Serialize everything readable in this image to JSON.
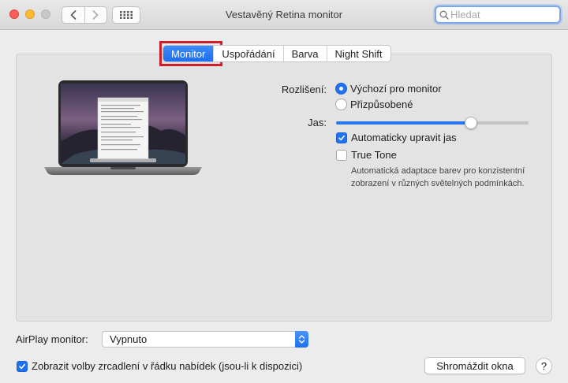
{
  "window": {
    "title": "Vestavěný Retina monitor",
    "search_placeholder": "Hledat"
  },
  "tabs": [
    {
      "label": "Monitor",
      "active": true
    },
    {
      "label": "Uspořádání",
      "active": false
    },
    {
      "label": "Barva",
      "active": false
    },
    {
      "label": "Night Shift",
      "active": false
    }
  ],
  "settings": {
    "resolution_label": "Rozlišení:",
    "resolution_options": [
      {
        "label": "Výchozí pro monitor",
        "selected": true
      },
      {
        "label": "Přizpůsobené",
        "selected": false
      }
    ],
    "brightness_label": "Jas:",
    "brightness_level": 0.7,
    "auto_brightness": {
      "label": "Automaticky upravit jas",
      "checked": true
    },
    "true_tone": {
      "label": "True Tone",
      "checked": false
    },
    "true_tone_description": "Automatická adaptace barev pro konzistentní zobrazení v různých světelných podmínkách."
  },
  "footer": {
    "airplay_label": "AirPlay monitor:",
    "airplay_value": "Vypnuto",
    "mirroring_option": {
      "label": "Zobrazit volby zrcadlení v řádku nabídek (jsou-li k dispozici)",
      "checked": true
    },
    "gather_button": "Shromáždit okna",
    "help": "?"
  },
  "colors": {
    "accent": "#1f72f2",
    "focus_ring": "#d11d27"
  }
}
